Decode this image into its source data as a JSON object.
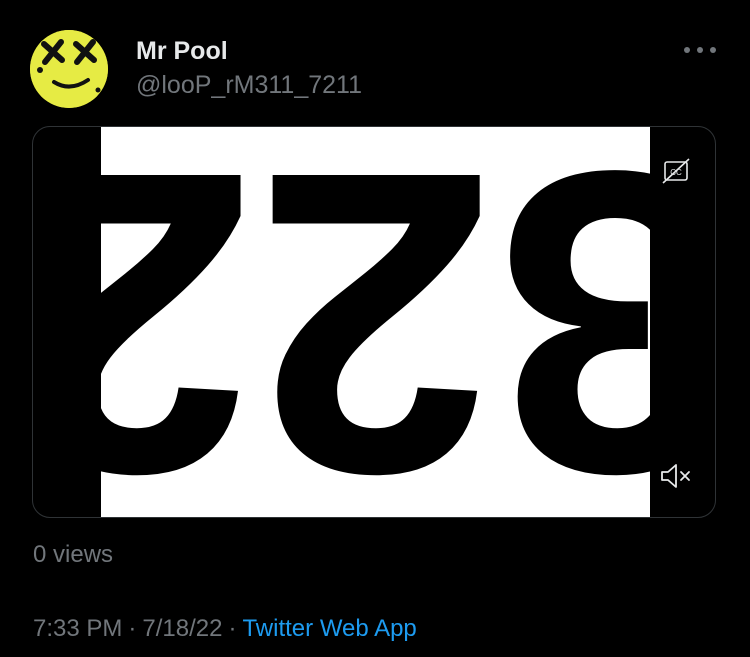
{
  "tweet": {
    "author": {
      "display_name": "Mr Pool",
      "handle": "@looP_rM311_7211",
      "avatar_icon": "dead-smiley-avatar"
    },
    "more_icon": "ellipsis-icon",
    "media": {
      "type": "video",
      "frame_text": "322",
      "frame_orientation": "rotated 180 degrees",
      "cc_icon": "closed-captions-off-icon",
      "mute_icon": "speaker-muted-icon"
    },
    "views": "0 views",
    "time": "7:33 PM",
    "separator": "·",
    "date": "7/18/22",
    "source": "Twitter Web App"
  },
  "colors": {
    "background": "#000000",
    "primary_text": "#e7e9ea",
    "secondary_text": "#71767b",
    "link": "#1d9bf0",
    "avatar_yellow": "#e6eb44"
  }
}
